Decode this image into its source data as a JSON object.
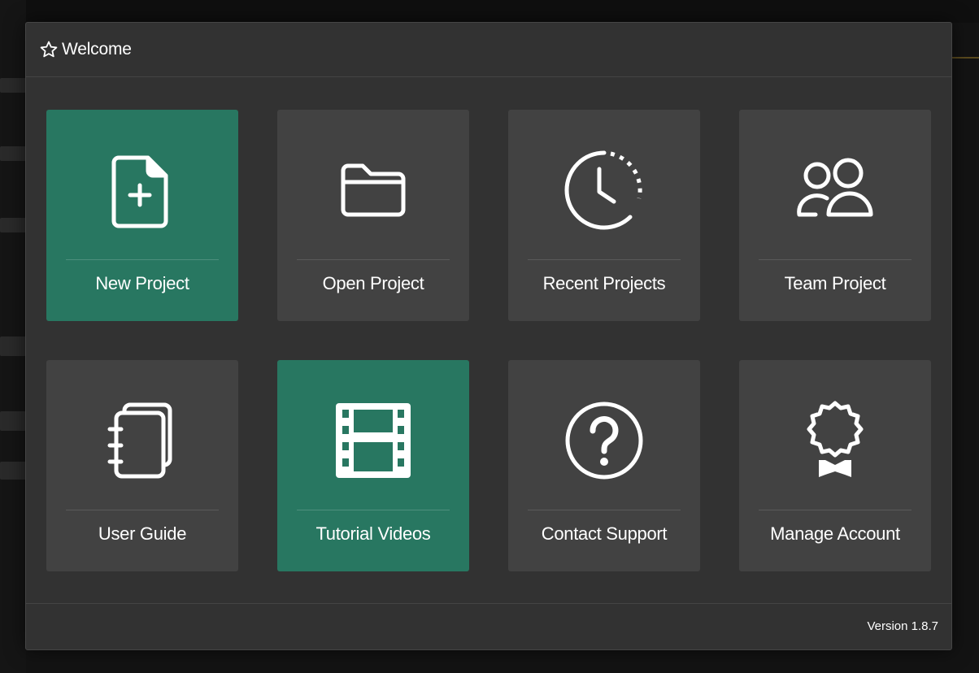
{
  "dialog": {
    "title": "Welcome",
    "title_icon": "star-outline-icon",
    "version": "Version 1.8.7"
  },
  "tiles": [
    {
      "label": "New Project",
      "icon": "new-file-icon",
      "highlighted": true
    },
    {
      "label": "Open Project",
      "icon": "folder-icon",
      "highlighted": false
    },
    {
      "label": "Recent Projects",
      "icon": "clock-icon",
      "highlighted": false
    },
    {
      "label": "Team Project",
      "icon": "users-icon",
      "highlighted": false
    },
    {
      "label": "User Guide",
      "icon": "notebook-icon",
      "highlighted": false
    },
    {
      "label": "Tutorial Videos",
      "icon": "film-icon",
      "highlighted": true
    },
    {
      "label": "Contact Support",
      "icon": "question-circle-icon",
      "highlighted": false
    },
    {
      "label": "Manage Account",
      "icon": "award-badge-icon",
      "highlighted": false
    }
  ],
  "colors": {
    "accent": "#287761",
    "tile": "#424242",
    "dialog": "#323232"
  }
}
